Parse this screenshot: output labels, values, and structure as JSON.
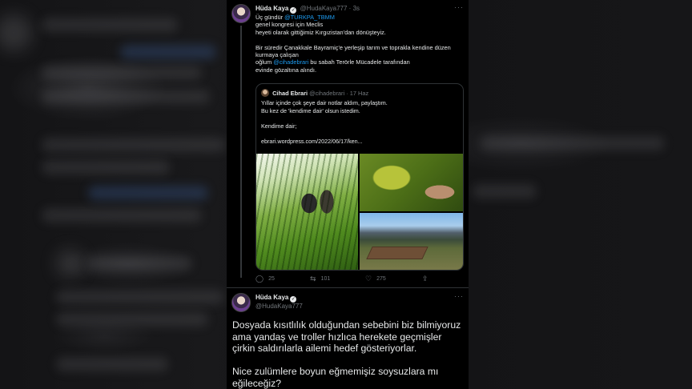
{
  "tweet1": {
    "name": "Hüda Kaya",
    "handle": "@HudaKaya777",
    "separator": "·",
    "time": "3s",
    "more": "···",
    "body": {
      "line1_pre": "Üç gündür ",
      "line1_link": "@TURKPA_TBMM",
      "line2": "genel kongresi için Meclis",
      "line3": "heyeti olarak gittiğimiz Kırgızistan'dan dönüşteyiz.",
      "line4": "Bir süredir Çanakkale Bayramiç'e yerleşip tarım ve toprakla kendine düzen",
      "line5": "kurmaya çalışan",
      "line6_pre": "oğlum ",
      "line6_link": "@cihadebrari",
      "line6_post": " bu sabah Terörle Mücadele tarafından",
      "line7": "evinde gözaltına alındı."
    },
    "quote": {
      "name": "Cihad Ebrari",
      "handle": "@cihadebrari",
      "separator": "·",
      "date": "17 Haz",
      "line1": "Yıllar içinde çok şeye dair notlar aldım, paylaştım.",
      "line2": "Bu kez de 'kendime dair' olsun istedim.",
      "line3": "Kendime dair;",
      "line4": "ebrari.wordpress.com/2022/06/17/ken..."
    },
    "actions": {
      "replies": "25",
      "retweets": "101",
      "likes": "275"
    }
  },
  "tweet2": {
    "name": "Hüda Kaya",
    "handle": "@HudaKaya777",
    "more": "···",
    "line1": "Dosyada kısıtlılık olduğundan sebebini biz bilmiyoruz",
    "line2": "ama yandaş ve troller hızlıca herekete geçmişler",
    "line3": "çirkin saldırılarla ailemi hedef gösteriyorlar.",
    "line4": "Nice zulümlere boyun eğmemişiz soysuzlara mı",
    "line5": "eğileceğiz?"
  },
  "icons": {
    "reply": "reply-icon",
    "retweet": "retweet-icon",
    "like": "heart-icon",
    "share": "share-icon",
    "verified": "verified-badge-icon"
  },
  "colors": {
    "background": "#000000",
    "text": "#e7e9ea",
    "secondary": "#71767b",
    "link": "#1d9bf0",
    "border": "#2f3336"
  }
}
